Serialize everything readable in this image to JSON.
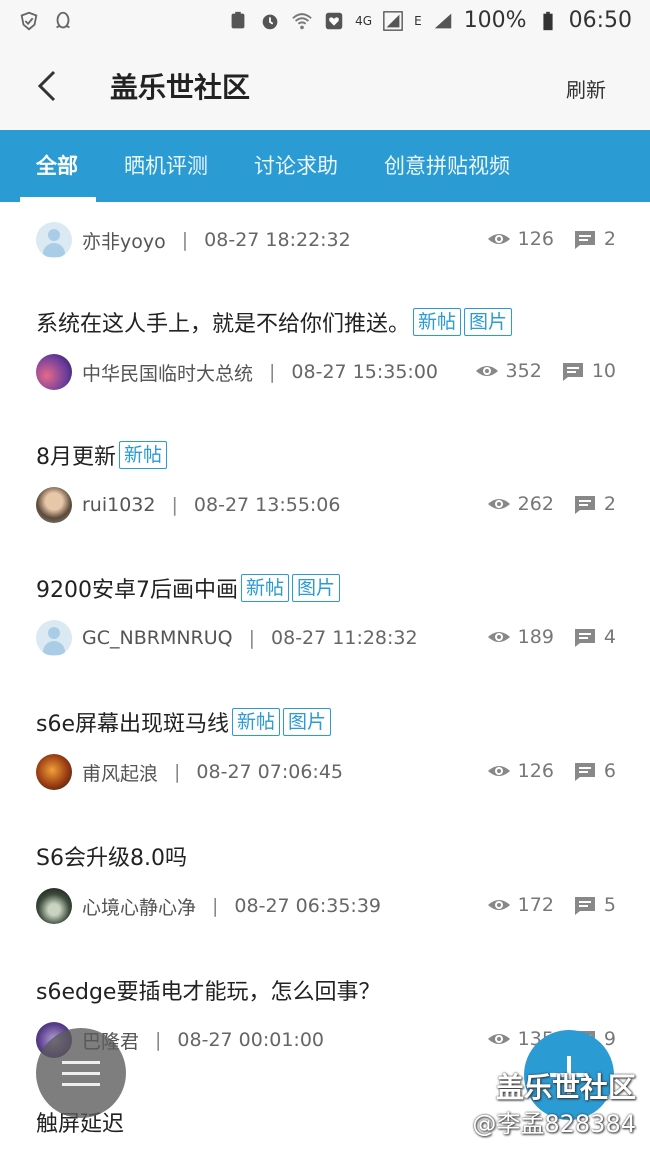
{
  "status_bar": {
    "battery": "100%",
    "time": "06:50",
    "network": "4G",
    "signal_e": "E"
  },
  "header": {
    "title": "盖乐世社区",
    "refresh": "刷新"
  },
  "tabs": [
    {
      "label": "全部",
      "active": true
    },
    {
      "label": "晒机评测",
      "active": false
    },
    {
      "label": "讨论求助",
      "active": false
    },
    {
      "label": "创意拼贴视频",
      "active": false
    }
  ],
  "posts": [
    {
      "title": "",
      "tags": [],
      "author": "亦非yoyo",
      "time": "08-27 18:22:32",
      "views": "126",
      "comments": "2"
    },
    {
      "title": "系统在这人手上，就是不给你们推送。",
      "tags": [
        "新帖",
        "图片"
      ],
      "author": "中华民国临时大总统",
      "time": "08-27 15:35:00",
      "views": "352",
      "comments": "10"
    },
    {
      "title": "8月更新",
      "tags": [
        "新帖"
      ],
      "author": "rui1032",
      "time": "08-27 13:55:06",
      "views": "262",
      "comments": "2"
    },
    {
      "title": "9200安卓7后画中画",
      "tags": [
        "新帖",
        "图片"
      ],
      "author": "GC_NBRMNRUQ",
      "time": "08-27 11:28:32",
      "views": "189",
      "comments": "4"
    },
    {
      "title": "s6e屏幕出现斑马线",
      "tags": [
        "新帖",
        "图片"
      ],
      "author": "甫风起浪",
      "time": "08-27 07:06:45",
      "views": "126",
      "comments": "6"
    },
    {
      "title": "S6会升级8.0吗",
      "tags": [],
      "author": "心境心静心净",
      "time": "08-27 06:35:39",
      "views": "172",
      "comments": "5"
    },
    {
      "title": "s6edge要插电才能玩，怎么回事？",
      "tags": [],
      "author": "巴隆君",
      "time": "08-27 00:01:00",
      "views": "135",
      "comments": "9"
    },
    {
      "title": "触屏延迟",
      "tags": [],
      "author": "",
      "time": "",
      "views": "",
      "comments": ""
    }
  ],
  "watermark": {
    "line1": "盖乐世社区",
    "line2": "@李孟828384"
  },
  "colors": {
    "accent": "#2b9bd3",
    "tag_border": "#2b9bd3"
  }
}
